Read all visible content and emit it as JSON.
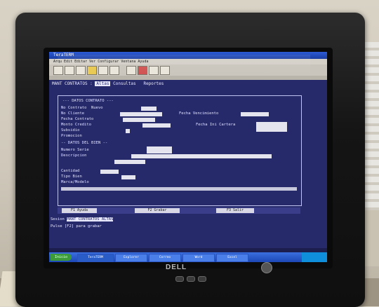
{
  "scene": {
    "monitor_brand": "DELL"
  },
  "window": {
    "title": "TeraTERM",
    "menu": "Arqu  Edit  Editar  Ver  Configurar  Ventana  Ayuda"
  },
  "terminal": {
    "nav_prefix": "MANT CONTRATOS :",
    "nav_selected": "Altas",
    "nav_rest": "Consultas   Reportes",
    "form_title": "--- DATOS CONTRATO ---",
    "labels": [
      "No Contrato  Nuevo",
      "No Cliente",
      "Fecha Contrato",
      "Monto Credito",
      "Subsidio",
      "Promocion",
      "-- DATOS DEL BIEN --",
      "Numero Serie",
      "Descripcion",
      "Cantidad",
      "Tipo Bien",
      "Marca/Modelo"
    ],
    "right_labels": [
      "Fecha Vencimiento",
      "Fecha Ini Cartera"
    ],
    "function_keys": [
      "F1 Ayuda",
      "F2 Grabar",
      "F3 Salir"
    ],
    "status_line_prefix": "Sesion",
    "status_line_highlight": "MANT CONTRATOS ALTAS",
    "status_line2": "Pulse [F2] para grabar"
  },
  "taskbar": {
    "start_label": "Inicio",
    "items": [
      "TeraTERM",
      "Explorer",
      "Correo",
      "Word",
      "Excel"
    ]
  }
}
